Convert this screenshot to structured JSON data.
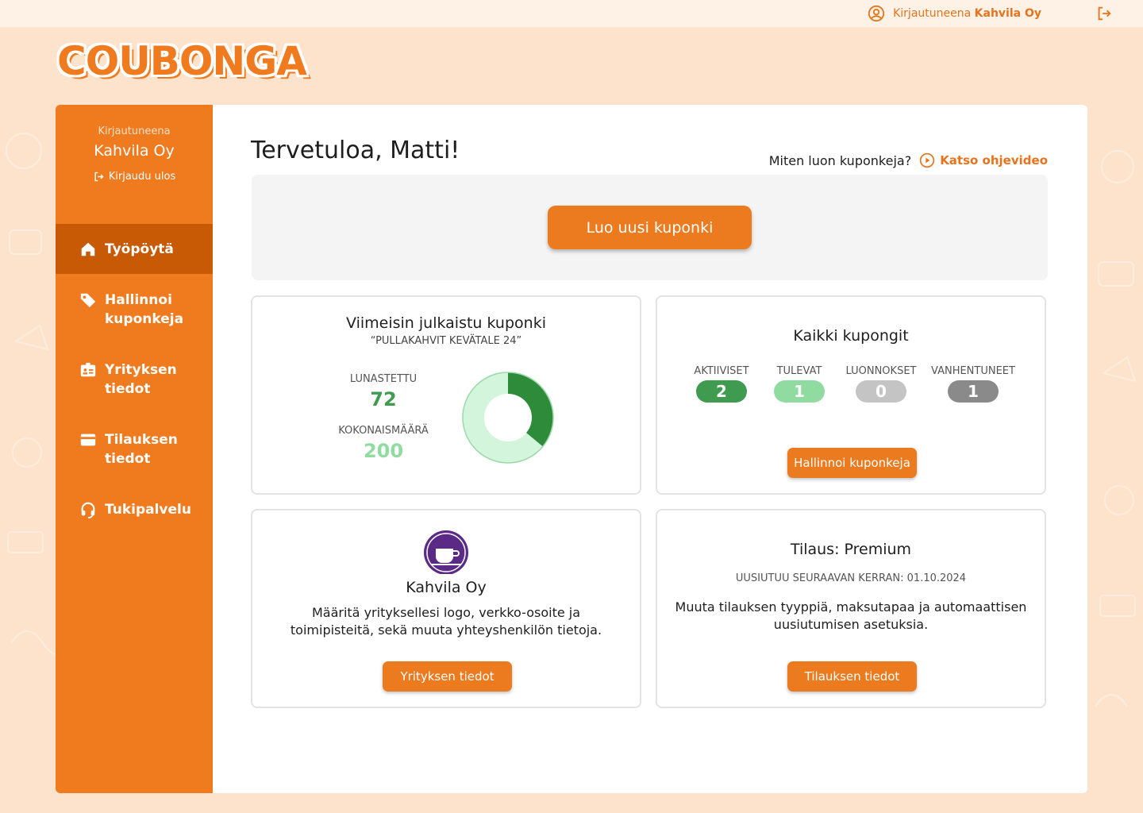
{
  "topbar": {
    "logged_in_prefix": "Kirjautuneena",
    "company": "Kahvila Oy"
  },
  "logo": {
    "text": "COUBONGA"
  },
  "sidebar": {
    "logged_in_label": "Kirjautuneena",
    "company": "Kahvila Oy",
    "logout_label": "Kirjaudu ulos",
    "items": [
      {
        "label": "Työpöytä",
        "icon": "home-icon",
        "active": true
      },
      {
        "label": "Hallinnoi kuponkeja",
        "icon": "tag-icon"
      },
      {
        "label": "Yrityksen tiedot",
        "icon": "id-card-icon"
      },
      {
        "label": "Tilauksen tiedot",
        "icon": "credit-card-icon"
      },
      {
        "label": "Tukipalvelu",
        "icon": "headset-icon"
      }
    ]
  },
  "main": {
    "welcome": "Tervetuloa, Matti!",
    "help_question": "Miten luon kuponkeja?",
    "help_link": "Katso ohjevideo",
    "create_button": "Luo uusi kuponki"
  },
  "latest_coupon": {
    "title": "Viimeisin julkaistu kuponki",
    "name": "“PULLAKAHVIT KEVÄTALE 24”",
    "redeemed_label": "LUNASTETTU",
    "redeemed_value": "72",
    "total_label": "KOKONAISMÄÄRÄ",
    "total_value": "200",
    "colors": {
      "redeemed": "#2e8b3a",
      "remaining": "#d3f5dc"
    }
  },
  "all_coupons": {
    "title": "Kaikki kupongit",
    "stats": [
      {
        "label": "AKTIIVISET",
        "value": "2",
        "color": "#3f9b4f"
      },
      {
        "label": "TULEVAT",
        "value": "1",
        "color": "#8fdba0"
      },
      {
        "label": "LUONNOKSET",
        "value": "0",
        "color": "#c4c4c4"
      },
      {
        "label": "VANHENTUNEET",
        "value": "1",
        "color": "#8a8a8a"
      }
    ],
    "button": "Hallinnoi kuponkeja"
  },
  "company_card": {
    "name": "Kahvila Oy",
    "description_line1": "Määritä yrityksellesi logo, verkko-osoite ja",
    "description_line2": "toimipisteitä, sekä muuta yhteyshenkilön tietoja.",
    "button": "Yrityksen tiedot"
  },
  "subscription_card": {
    "title": "Tilaus: Premium",
    "renewal": "UUSIUTUU SEURAAVAN KERRAN: 01.10.2024",
    "description_line1": "Muuta tilauksen tyyppiä, maksutapaa ja automaattisen",
    "description_line2": "uusiutumisen asetuksia.",
    "button": "Tilauksen tiedot"
  },
  "chart_data": {
    "type": "pie",
    "categories": [
      "LUNASTETTU",
      "KOKONAISMÄÄRÄ"
    ],
    "values": [
      72,
      200
    ]
  }
}
